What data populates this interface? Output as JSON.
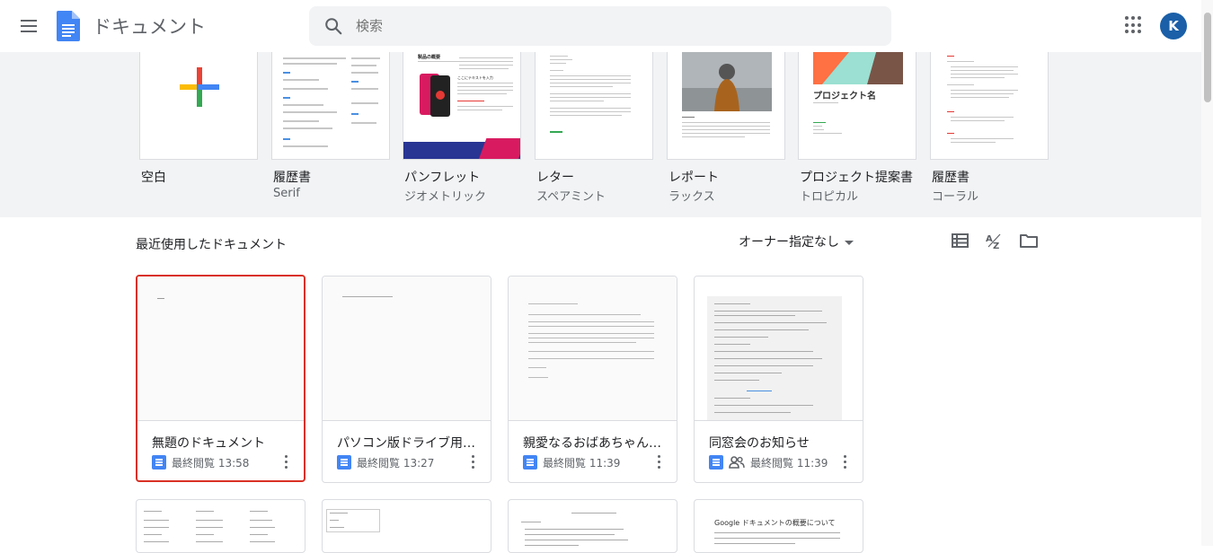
{
  "header": {
    "app_title": "ドキュメント",
    "search_placeholder": "検索",
    "avatar_letter": "K"
  },
  "templates": [
    {
      "name": "空白",
      "subtitle": ""
    },
    {
      "name": "履歴書",
      "subtitle": "Serif"
    },
    {
      "name": "パンフレット",
      "subtitle": "ジオメトリック"
    },
    {
      "name": "レター",
      "subtitle": "スペアミント"
    },
    {
      "name": "レポート",
      "subtitle": "ラックス"
    },
    {
      "name": "プロジェクト提案書",
      "subtitle": "トロピカル"
    },
    {
      "name": "履歴書",
      "subtitle": "コーラル"
    }
  ],
  "template_previews": {
    "brochure_heading": "製品の概要",
    "brochure_sub": "ここにテキストを入力",
    "project_title": "プロジェクト名"
  },
  "recent": {
    "title": "最近使用したドキュメント",
    "owner_filter": "オーナー指定なし",
    "docs": [
      {
        "title": "無題のドキュメント",
        "opened": "最終閲覧 13:58",
        "shared": false,
        "selected": true
      },
      {
        "title": "パソコン版ドライブ用ドキュメント",
        "opened": "最終閲覧 13:27",
        "shared": false,
        "selected": false
      },
      {
        "title": "親愛なるおばあちゃんへ、",
        "opened": "最終閲覧 11:39",
        "shared": false,
        "selected": false
      },
      {
        "title": "同窓会のお知らせ",
        "opened": "最終閲覧 11:39",
        "shared": true,
        "selected": false
      }
    ],
    "second_row_preview_text": "Google ドキュメントの概要について"
  },
  "colors": {
    "accent_blue": "#4285f4",
    "selection_red": "#d93025",
    "avatar_bg": "#1a5fa8"
  }
}
